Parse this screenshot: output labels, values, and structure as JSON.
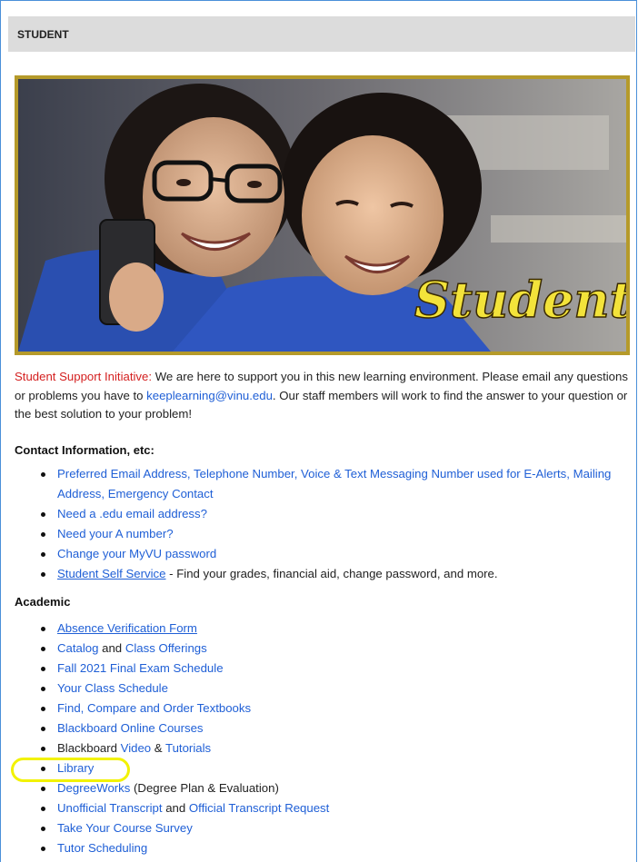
{
  "header": {
    "title": "STUDENT"
  },
  "hero": {
    "overlay_text": "Student"
  },
  "intro": {
    "label": "Student Support Initiative:",
    "text1": " We are here to support you in this new learning environment. Please email any questions or problems you have to ",
    "email": "keeplearning@vinu.edu",
    "text2": ". Our staff members will work to find the answer to your question or the best solution to your problem!"
  },
  "contact": {
    "heading": "Contact Information, etc:",
    "items": {
      "preferred": "Preferred Email Address, Telephone Number, Voice & Text Messaging Number used for E-Alerts, Mailing Address, Emergency Contact",
      "edu_email": "Need a .edu email address?",
      "a_number": "Need your A number?",
      "password": "Change your MyVU password",
      "self_service_link": "Student Self Service",
      "self_service_text": " - Find your grades, financial aid, change password, and more."
    }
  },
  "academic": {
    "heading": "Academic",
    "items": {
      "absence": "Absence Verification Form",
      "catalog": "Catalog",
      "and1": " and ",
      "class_offerings": "Class Offerings",
      "final_exam": "Fall 2021 Final Exam Schedule",
      "class_schedule": "Your Class Schedule",
      "textbooks": "Find, Compare and Order Textbooks",
      "blackboard_online": "Blackboard Online Courses",
      "blackboard_prefix": "Blackboard ",
      "video": "Video",
      "amp": " & ",
      "tutorials": "Tutorials",
      "library": "Library",
      "degreeworks": "DegreeWorks",
      "degreeworks_text": " (Degree Plan & Evaluation)",
      "unofficial": "Unofficial Transcript",
      "and2": " and ",
      "official": "Official Transcript Request",
      "survey": "Take Your Course Survey",
      "tutor": "Tutor Scheduling"
    }
  },
  "colors": {
    "link": "#1f5fd6",
    "accent_red": "#d42020",
    "highlight": "#f2f200",
    "frame_border": "#b59a2a"
  }
}
